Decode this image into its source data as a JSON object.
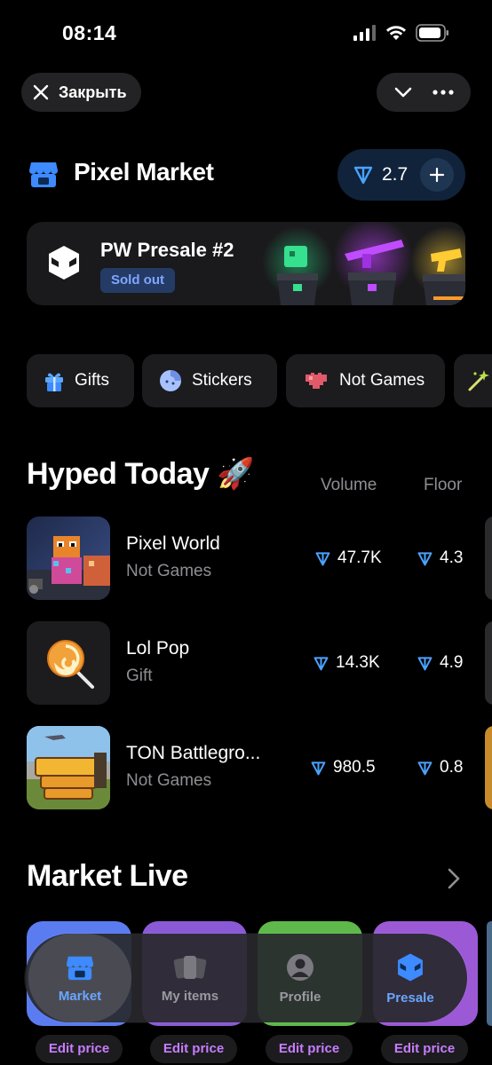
{
  "status_bar": {
    "time": "08:14"
  },
  "top_bar": {
    "close_label": "Закрыть"
  },
  "header": {
    "title": "Pixel Market",
    "balance": "2.7"
  },
  "banner": {
    "title": "PW Presale #2",
    "badge": "Sold out"
  },
  "categories": [
    {
      "label": "Gifts",
      "icon": "gift-icon"
    },
    {
      "label": "Stickers",
      "icon": "sticker-icon"
    },
    {
      "label": "Not Games",
      "icon": "heart-pixel-icon"
    },
    {
      "label": "",
      "icon": "sparkle-wand-icon"
    }
  ],
  "hyped": {
    "title": "Hyped Today 🚀",
    "columns": {
      "volume": "Volume",
      "floor": "Floor"
    },
    "items": [
      {
        "name": "Pixel World",
        "category": "Not Games",
        "volume": "47.7K",
        "floor": "4.3"
      },
      {
        "name": "Lol Pop",
        "category": "Gift",
        "volume": "14.3K",
        "floor": "4.9"
      },
      {
        "name": "TON Battlegro...",
        "category": "Not Games",
        "volume": "980.5",
        "floor": "0.8"
      }
    ]
  },
  "market_live": {
    "title": "Market Live",
    "cards": [
      {
        "color": "#5b7cf0",
        "action": "Edit price"
      },
      {
        "color": "#8a5ad6",
        "action": "Edit price"
      },
      {
        "color": "#5fb84a",
        "action": "Edit price"
      },
      {
        "color": "#9b59d6",
        "action": "Edit price"
      }
    ]
  },
  "tabbar": {
    "tabs": [
      {
        "label": "Market",
        "icon": "store-icon",
        "active": true
      },
      {
        "label": "My items",
        "icon": "cards-icon",
        "active": false
      },
      {
        "label": "Profile",
        "icon": "profile-icon",
        "active": false
      },
      {
        "label": "Presale",
        "icon": "cube-face-icon",
        "active": false
      }
    ]
  },
  "colors": {
    "accent": "#3d8bff",
    "ton": "#4aa3ff",
    "purple": "#c77dff",
    "background": "#000000"
  }
}
